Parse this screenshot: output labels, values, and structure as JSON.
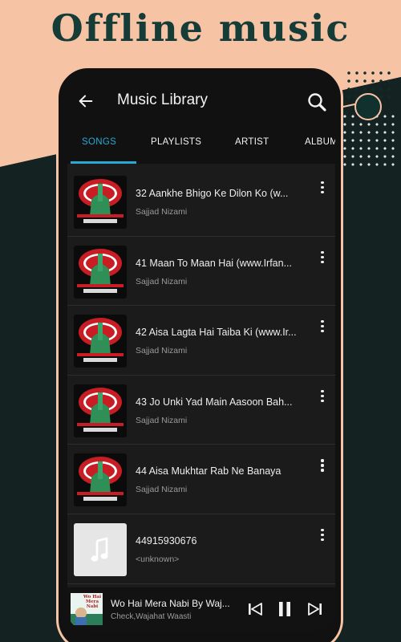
{
  "promo": {
    "headline": "Offline music"
  },
  "app": {
    "title": "Music Library",
    "tabs": [
      {
        "label": "SONGS",
        "active": true
      },
      {
        "label": "PLAYLISTS",
        "active": false
      },
      {
        "label": "ARTIST",
        "active": false
      },
      {
        "label": "ALBUM",
        "active": false
      }
    ],
    "songs": [
      {
        "title": "32 Aankhe Bhigo Ke Dilon Ko (w...",
        "artist": "Sajjad Nizami",
        "art": "album-art"
      },
      {
        "title": "41 Maan To Maan Hai (www.Irfan...",
        "artist": "Sajjad Nizami",
        "art": "album-art"
      },
      {
        "title": "42 Aisa Lagta Hai Taiba Ki (www.Ir...",
        "artist": "Sajjad Nizami",
        "art": "album-art"
      },
      {
        "title": "43 Jo Unki Yad Main Aasoon Bah...",
        "artist": "Sajjad Nizami",
        "art": "album-art"
      },
      {
        "title": "44 Aisa Mukhtar Rab Ne Banaya",
        "artist": "Sajjad Nizami",
        "art": "album-art"
      },
      {
        "title": "44915930676",
        "artist": "<unknown>",
        "art": "music-note-icon"
      }
    ],
    "now_playing": {
      "title": "Wo Hai Mera Nabi By Waj...",
      "artist": "Check,Wajahat Waasti",
      "thumb_text": "Wo Hai Mera Nabi"
    }
  },
  "colors": {
    "accent": "#29a9d6",
    "peach": "#f6c3a5",
    "background_dark": "#142222",
    "headline": "#163c38"
  }
}
